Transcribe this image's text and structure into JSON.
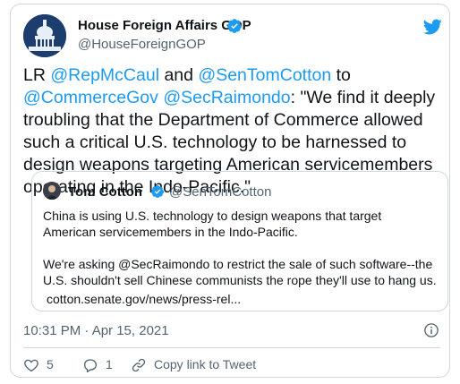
{
  "account": {
    "name": "House Foreign Affairs GOP",
    "handle": "@HouseForeignGOP"
  },
  "tweet": {
    "prefix": "LR ",
    "mention1": "@RepMcCaul",
    "and": " and ",
    "mention2": "@SenTomCotton",
    "to": " to ",
    "mention3": "@CommerceGov",
    "space": " ",
    "mention4": "@SecRaimondo",
    "body": ": \"We find it deeply troubling that the Department of Commerce allowed such a critical U.S. technology to be harnessed to design weapons targeting American servicemembers operating in the Indo-Pacific.\""
  },
  "quote": {
    "name": "Tom Cotton",
    "handle": "@SenTomCotton",
    "paragraph1": "China is using U.S. technology to design weapons that target American servicemembers in the Indo-Pacific.",
    "paragraph2": "We're asking @SecRaimondo to restrict the sale of such software--the U.S. shouldn't sell Chinese communists the rope they'll use to hang us.",
    "link": "cotton.senate.gov/news/press-rel..."
  },
  "timestamp": "10:31 PM · Apr 15, 2021",
  "actions": {
    "likes": "5",
    "replies": "1",
    "copy_link": "Copy link to Tweet"
  },
  "colors": {
    "accent": "#1d9bf0",
    "text": "#0f1419",
    "secondary": "#536471",
    "border": "#cfd9de"
  },
  "icons": {
    "verified": "verified-badge-icon",
    "twitter": "twitter-bird-icon",
    "info": "info-icon",
    "like": "heart-icon",
    "reply": "reply-icon",
    "link": "link-icon"
  }
}
